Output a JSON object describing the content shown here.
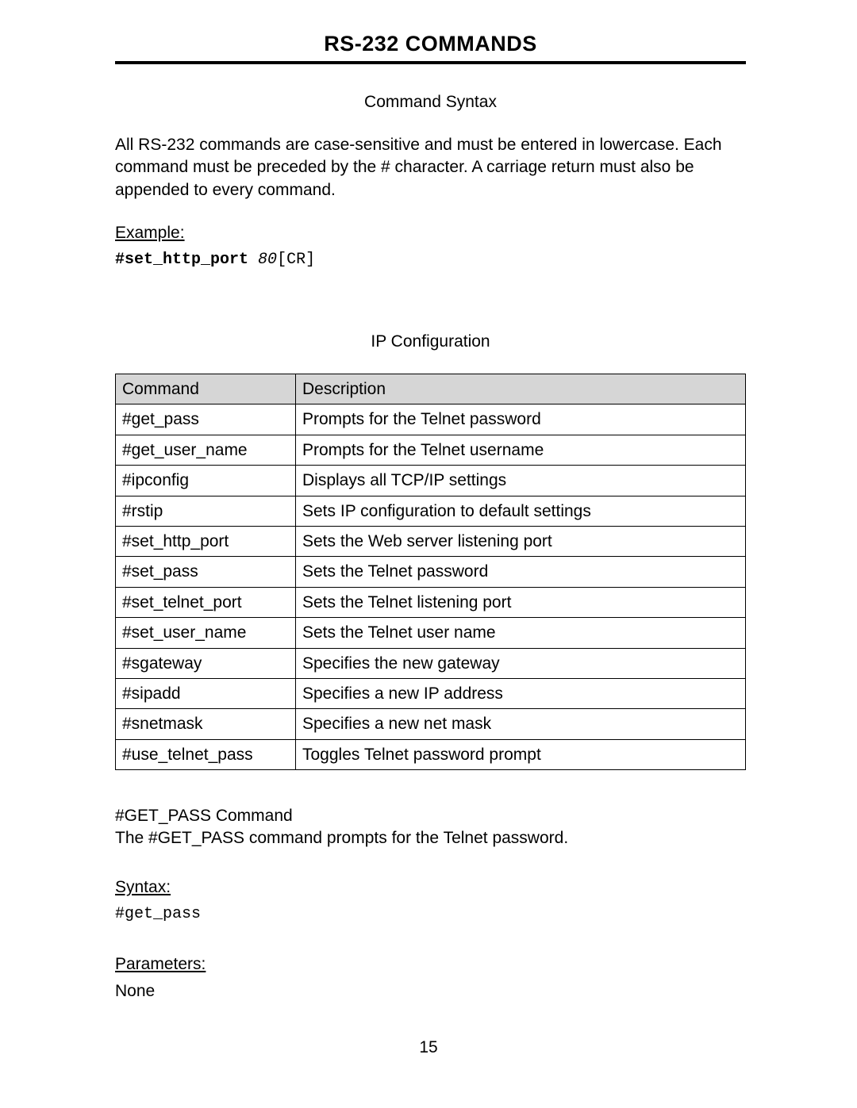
{
  "header": {
    "title": "RS-232 COMMANDS"
  },
  "syntax_section": {
    "heading": "Command Syntax",
    "intro": "All RS-232 commands are case-sensitive and must be entered in lowercase. Each command must be preceded by the  #  character.  A carriage return must also be appended to every command.",
    "example_label": "Example:",
    "example_cmd": "#set_http_port",
    "example_arg": "80",
    "example_cr": "[CR]"
  },
  "ip_section": {
    "heading": "IP Conﬁguration",
    "table": {
      "headers": {
        "command": "Command",
        "description": "Description"
      },
      "rows": [
        {
          "cmd": "#get_pass",
          "desc": "Prompts for the Telnet password"
        },
        {
          "cmd": "#get_user_name",
          "desc": "Prompts for the Telnet username"
        },
        {
          "cmd": "#ipconﬁg",
          "desc": "Displays all TCP/IP settings"
        },
        {
          "cmd": "#rstip",
          "desc": "Sets IP conﬁguration to default settings"
        },
        {
          "cmd": "#set_http_port",
          "desc": "Sets the Web server listening port"
        },
        {
          "cmd": "#set_pass",
          "desc": "Sets the Telnet password"
        },
        {
          "cmd": "#set_telnet_port",
          "desc": "Sets the Telnet listening port"
        },
        {
          "cmd": "#set_user_name",
          "desc": "Sets the Telnet user name"
        },
        {
          "cmd": "#sgateway",
          "desc": "Speciﬁes the new gateway"
        },
        {
          "cmd": "#sipadd",
          "desc": "Speciﬁes a new IP address"
        },
        {
          "cmd": "#snetmask",
          "desc": "Speciﬁes a new net mask"
        },
        {
          "cmd": "#use_telnet_pass",
          "desc": "Toggles Telnet password prompt"
        }
      ]
    }
  },
  "get_pass": {
    "heading": "#GET_PASS Command",
    "description": "The #GET_PASS command prompts for the Telnet password.",
    "syntax_label": "Syntax:",
    "syntax_code": "#get_pass",
    "params_label": "Parameters:",
    "params_value": "None"
  },
  "page_number": "15"
}
